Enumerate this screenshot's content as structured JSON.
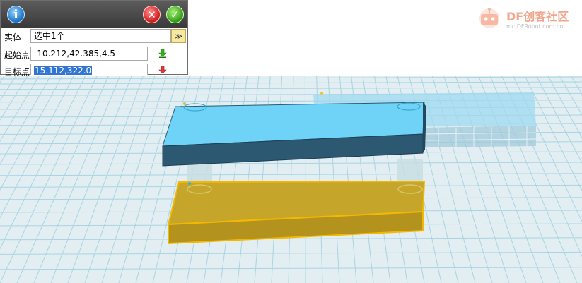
{
  "dialog": {
    "entity_label": "实体",
    "entity_value": "选中1个",
    "dropdown_glyph": "≫",
    "start_label": "起始点",
    "start_value": "-10.212,42.385,4.5",
    "target_label": "目标点",
    "target_value": "15.112,322.0",
    "info_glyph": "i",
    "cancel_glyph": "✕",
    "confirm_glyph": "✓",
    "pick_start_icon": "green-down-arrow-icon",
    "pick_target_icon": "red-down-arrow-icon"
  },
  "watermark": {
    "title": "DF创客社区",
    "subtitle": "mc.DFRobot.com.cn"
  },
  "colors": {
    "grid_bg": "#e2eef1",
    "grid_line": "#a9d4e4",
    "top_block_top": "#6fd3f7",
    "top_block_front": "#2c5872",
    "bottom_block": "#b89a1e",
    "bottom_outline": "#f5b800",
    "ghost_block": "#9dd9ef"
  }
}
